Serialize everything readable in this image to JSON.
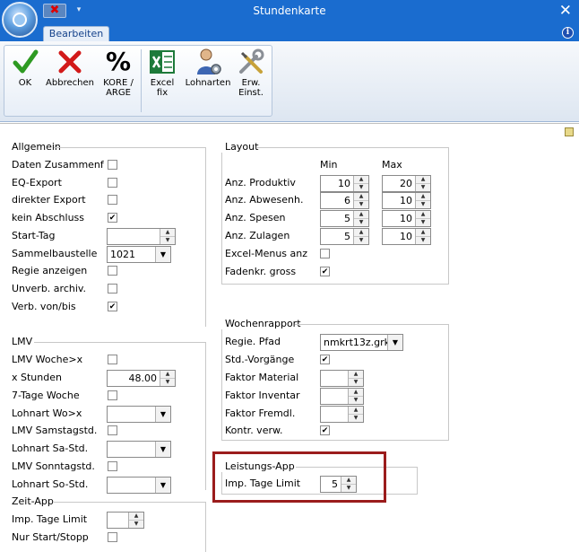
{
  "window": {
    "title": "Stundenkarte"
  },
  "qat": {
    "close_x": "✖",
    "dropdown": "▾"
  },
  "tabs": [
    {
      "label": "Bearbeiten"
    }
  ],
  "ribbon": {
    "buttons": [
      {
        "name": "ok-button",
        "label": "OK",
        "icon": "check-icon"
      },
      {
        "name": "abbrechen-button",
        "label": "Abbrechen",
        "icon": "x-icon"
      },
      {
        "name": "kore-arge-button",
        "label": "KORE / ARGE",
        "icon": "percent-icon"
      },
      {
        "name": "excel-fix-button",
        "label": "Excel fix",
        "icon": "excel-icon"
      },
      {
        "name": "lohnarten-button",
        "label": "Lohnarten",
        "icon": "person-gear-icon"
      },
      {
        "name": "erw-einst-button",
        "label": "Erw. Einst.",
        "icon": "tools-icon"
      }
    ]
  },
  "allgemein": {
    "title": "Allgemein",
    "daten_zusammenf": {
      "label": "Daten Zusammenf",
      "checked": false
    },
    "eq_export": {
      "label": "EQ-Export",
      "checked": false
    },
    "direkter_export": {
      "label": "direkter Export",
      "checked": false
    },
    "kein_abschluss": {
      "label": "kein Abschluss",
      "checked": true
    },
    "start_tag": {
      "label": "Start-Tag",
      "value": ""
    },
    "sammelbaustelle": {
      "label": "Sammelbaustelle",
      "value": "1021"
    },
    "regie_anzeigen": {
      "label": "Regie anzeigen",
      "checked": false
    },
    "unverb_archiv": {
      "label": "Unverb. archiv.",
      "checked": false
    },
    "verb_von_bis": {
      "label": "Verb. von/bis",
      "checked": true
    }
  },
  "lmv": {
    "title": "LMV",
    "lmv_woche": {
      "label": "LMV Woche>x",
      "checked": false
    },
    "x_stunden": {
      "label": "x Stunden",
      "value": "48.00"
    },
    "tage7_woche": {
      "label": "7-Tage Woche",
      "checked": false
    },
    "lohnart_wo": {
      "label": "Lohnart Wo>x",
      "value": ""
    },
    "lmv_samstag": {
      "label": "LMV Samstagstd.",
      "checked": false
    },
    "lohnart_sa": {
      "label": "Lohnart Sa-Std.",
      "value": ""
    },
    "lmv_sonntag": {
      "label": "LMV Sonntagstd.",
      "checked": false
    },
    "lohnart_so": {
      "label": "Lohnart So-Std.",
      "value": ""
    }
  },
  "zeit_app": {
    "title": "Zeit-App",
    "imp_tage_limit": {
      "label": "Imp. Tage Limit",
      "value": ""
    },
    "nur_start_stopp": {
      "label": "Nur Start/Stopp",
      "checked": false
    }
  },
  "layout": {
    "title": "Layout",
    "col_min": "Min",
    "col_max": "Max",
    "anz_produktiv": {
      "label": "Anz. Produktiv",
      "min": "10",
      "max": "20"
    },
    "anz_abwesenh": {
      "label": "Anz. Abwesenh.",
      "min": "6",
      "max": "10"
    },
    "anz_spesen": {
      "label": "Anz. Spesen",
      "min": "5",
      "max": "10"
    },
    "anz_zulagen": {
      "label": "Anz. Zulagen",
      "min": "5",
      "max": "10"
    },
    "excel_menus": {
      "label": "Excel-Menus anz",
      "checked": false
    },
    "fadenkr_gross": {
      "label": "Fadenkr. gross",
      "checked": true
    }
  },
  "wochenrapport": {
    "title": "Wochenrapport",
    "regie_pfad": {
      "label": "Regie. Pfad",
      "value": "nmkrt13z.grk"
    },
    "std_vorgaenge": {
      "label": "Std.-Vorgänge",
      "checked": true
    },
    "faktor_material": {
      "label": "Faktor Material",
      "value": ""
    },
    "faktor_inventar": {
      "label": "Faktor Inventar",
      "value": ""
    },
    "faktor_fremdl": {
      "label": "Faktor Fremdl.",
      "value": ""
    },
    "kontr_verw": {
      "label": "Kontr. verw.",
      "checked": true
    }
  },
  "leistungs_app": {
    "title": "Leistungs-App",
    "imp_tage_limit": {
      "label": "Imp. Tage Limit",
      "value": "5"
    }
  }
}
